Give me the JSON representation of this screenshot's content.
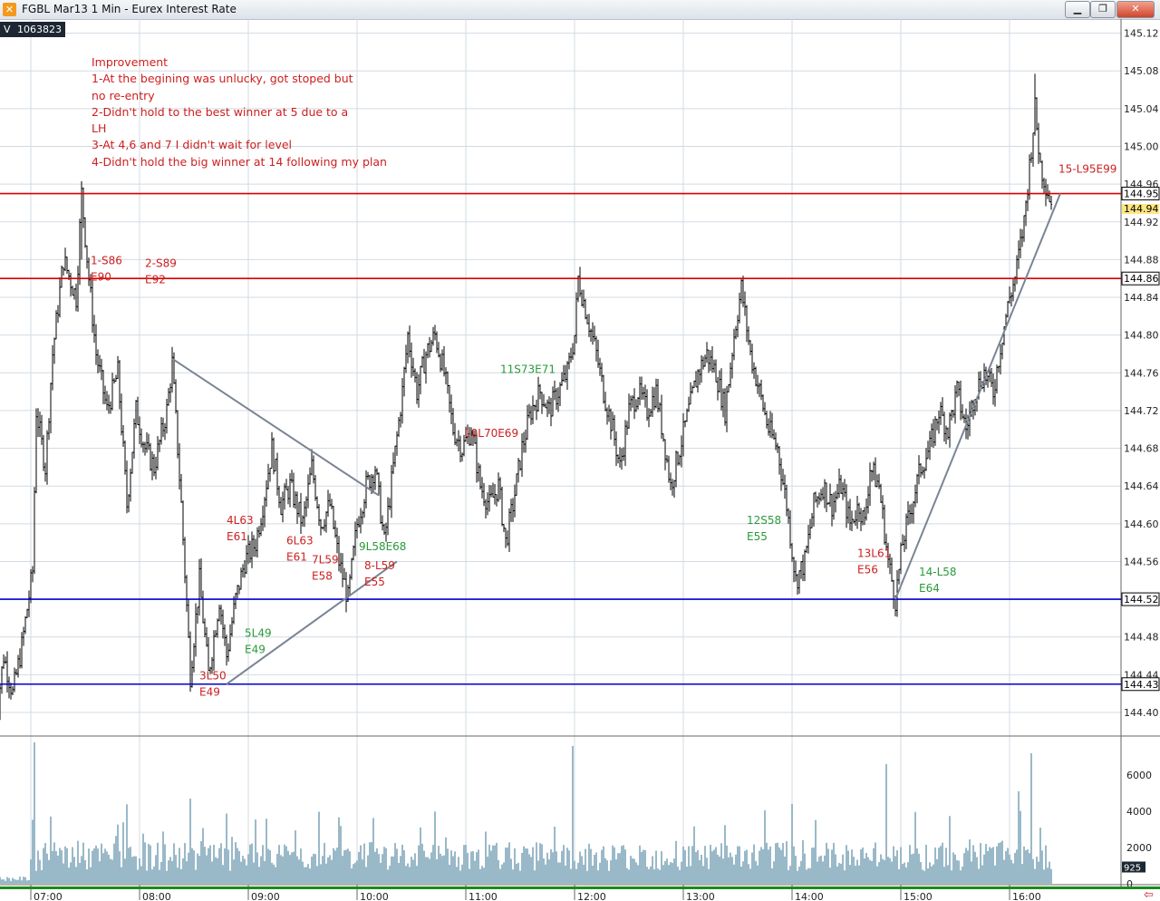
{
  "window": {
    "title": "FGBL Mar13 1 Min - Eurex Interest Rate",
    "buttons": {
      "minimize": "▁",
      "restore": "❐",
      "close": "✕"
    }
  },
  "volume_badge": {
    "label": "V",
    "value": "1063823"
  },
  "notes": [
    "Improvement",
    "1-At the begining was unlucky, got stoped but",
    "no re-entry",
    " 2-Didn't hold to the best winner at 5 due to a",
    "LH",
    "3-At 4,6 and 7 I didn't wait for level",
    "4-Didn't hold the big winner at 14 following my plan"
  ],
  "colors": {
    "candles": "#000000",
    "resistance": "#dd0000",
    "support": "#0000cc",
    "trendline": "#7a8494",
    "short_label": "#cc2020",
    "long_label": "#2a9a3a",
    "volume_bar": "#6f9bb0",
    "current_price_tag": "#ffe680"
  },
  "chart_data": {
    "type": "candlestick",
    "instrument": "FGBL Mar13",
    "timeframe": "1 Min",
    "x_ticks": [
      "07:00",
      "08:00",
      "09:00",
      "10:00",
      "11:00",
      "12:00",
      "13:00",
      "14:00",
      "15:00",
      "16:00"
    ],
    "y_ticks": [
      "145.12",
      "145.08",
      "145.04",
      "145.00",
      "144.96",
      "144.92",
      "144.88",
      "144.84",
      "144.80",
      "144.76",
      "144.72",
      "144.68",
      "144.64",
      "144.60",
      "144.56",
      "144.52",
      "144.48",
      "144.44",
      "144.40"
    ],
    "ylim": [
      144.375,
      145.135
    ],
    "close_path": [
      [
        "06:40",
        144.38
      ],
      [
        "06:45",
        144.46
      ],
      [
        "06:50",
        144.42
      ],
      [
        "06:55",
        144.47
      ],
      [
        "07:01",
        144.55
      ],
      [
        "07:03",
        144.72
      ],
      [
        "07:08",
        144.66
      ],
      [
        "07:12",
        144.78
      ],
      [
        "07:18",
        144.88
      ],
      [
        "07:25",
        144.84
      ],
      [
        "07:28",
        144.95
      ],
      [
        "07:32",
        144.86
      ],
      [
        "07:36",
        144.78
      ],
      [
        "07:42",
        144.72
      ],
      [
        "07:48",
        144.76
      ],
      [
        "07:53",
        144.62
      ],
      [
        "07:58",
        144.72
      ],
      [
        "08:03",
        144.68
      ],
      [
        "08:08",
        144.66
      ],
      [
        "08:15",
        144.72
      ],
      [
        "08:18",
        144.77
      ],
      [
        "08:23",
        144.62
      ],
      [
        "08:28",
        144.44
      ],
      [
        "08:33",
        144.54
      ],
      [
        "08:38",
        144.44
      ],
      [
        "08:44",
        144.52
      ],
      [
        "08:48",
        144.46
      ],
      [
        "08:53",
        144.52
      ],
      [
        "08:58",
        144.56
      ],
      [
        "09:04",
        144.58
      ],
      [
        "09:08",
        144.62
      ],
      [
        "09:13",
        144.68
      ],
      [
        "09:18",
        144.62
      ],
      [
        "09:23",
        144.64
      ],
      [
        "09:30",
        144.6
      ],
      [
        "09:35",
        144.66
      ],
      [
        "09:40",
        144.6
      ],
      [
        "09:45",
        144.62
      ],
      [
        "09:50",
        144.56
      ],
      [
        "09:55",
        144.52
      ],
      [
        "10:00",
        144.6
      ],
      [
        "10:05",
        144.64
      ],
      [
        "10:10",
        144.66
      ],
      [
        "10:15",
        144.58
      ],
      [
        "10:20",
        144.66
      ],
      [
        "10:25",
        144.74
      ],
      [
        "10:28",
        144.8
      ],
      [
        "10:33",
        144.74
      ],
      [
        "10:38",
        144.78
      ],
      [
        "10:43",
        144.8
      ],
      [
        "10:48",
        144.76
      ],
      [
        "10:53",
        144.7
      ],
      [
        "10:58",
        144.68
      ],
      [
        "11:03",
        144.7
      ],
      [
        "11:08",
        144.64
      ],
      [
        "11:13",
        144.62
      ],
      [
        "11:18",
        144.64
      ],
      [
        "11:22",
        144.58
      ],
      [
        "11:26",
        144.62
      ],
      [
        "11:31",
        144.68
      ],
      [
        "11:36",
        144.72
      ],
      [
        "11:41",
        144.74
      ],
      [
        "11:46",
        144.72
      ],
      [
        "11:51",
        144.74
      ],
      [
        "11:56",
        144.76
      ],
      [
        "12:00",
        144.8
      ],
      [
        "12:02",
        144.86
      ],
      [
        "12:07",
        144.82
      ],
      [
        "12:12",
        144.78
      ],
      [
        "12:16",
        144.74
      ],
      [
        "12:21",
        144.7
      ],
      [
        "12:25",
        144.66
      ],
      [
        "12:30",
        144.72
      ],
      [
        "12:35",
        144.74
      ],
      [
        "12:40",
        144.72
      ],
      [
        "12:45",
        144.74
      ],
      [
        "12:50",
        144.68
      ],
      [
        "12:53",
        144.64
      ],
      [
        "12:58",
        144.68
      ],
      [
        "13:03",
        144.72
      ],
      [
        "13:08",
        144.76
      ],
      [
        "13:13",
        144.78
      ],
      [
        "13:18",
        144.76
      ],
      [
        "13:23",
        144.72
      ],
      [
        "13:28",
        144.8
      ],
      [
        "13:32",
        144.85
      ],
      [
        "13:37",
        144.78
      ],
      [
        "13:42",
        144.74
      ],
      [
        "13:47",
        144.7
      ],
      [
        "13:52",
        144.68
      ],
      [
        "13:57",
        144.62
      ],
      [
        "14:02",
        144.54
      ],
      [
        "14:07",
        144.56
      ],
      [
        "14:12",
        144.62
      ],
      [
        "14:17",
        144.64
      ],
      [
        "14:22",
        144.62
      ],
      [
        "14:27",
        144.64
      ],
      [
        "14:32",
        144.6
      ],
      [
        "14:37",
        144.62
      ],
      [
        "14:40",
        144.6
      ],
      [
        "14:43",
        144.66
      ],
      [
        "14:48",
        144.64
      ],
      [
        "14:53",
        144.56
      ],
      [
        "14:57",
        144.52
      ],
      [
        "15:01",
        144.58
      ],
      [
        "15:06",
        144.62
      ],
      [
        "15:11",
        144.66
      ],
      [
        "15:16",
        144.68
      ],
      [
        "15:21",
        144.72
      ],
      [
        "15:26",
        144.7
      ],
      [
        "15:31",
        144.74
      ],
      [
        "15:36",
        144.7
      ],
      [
        "15:41",
        144.74
      ],
      [
        "15:46",
        144.76
      ],
      [
        "15:51",
        144.74
      ],
      [
        "15:56",
        144.8
      ],
      [
        "16:00",
        144.84
      ],
      [
        "16:03",
        144.86
      ],
      [
        "16:08",
        144.92
      ],
      [
        "16:11",
        144.98
      ],
      [
        "16:14",
        145.04
      ],
      [
        "16:17",
        144.98
      ],
      [
        "16:20",
        144.96
      ],
      [
        "16:23",
        144.94
      ]
    ],
    "last_price": "144.94",
    "horizontal_levels": [
      {
        "price": 144.95,
        "label": "144.95",
        "kind": "resistance"
      },
      {
        "price": 144.86,
        "label": "144.86",
        "kind": "resistance"
      },
      {
        "price": 144.52,
        "label": "144.52",
        "kind": "support"
      },
      {
        "price": 144.43,
        "label": "144.43",
        "kind": "support"
      }
    ],
    "trendlines": [
      {
        "from": [
          "08:18",
          144.775
        ],
        "to": [
          "10:12",
          144.63
        ]
      },
      {
        "from": [
          "08:48",
          144.43
        ],
        "to": [
          "10:22",
          144.56
        ]
      },
      {
        "from": [
          "14:57",
          144.52
        ],
        "to": [
          "16:28",
          144.95
        ]
      }
    ],
    "trade_labels": [
      {
        "time": "07:33",
        "price": 144.875,
        "lines": [
          "1-S86",
          "E90"
        ],
        "side": "short"
      },
      {
        "time": "08:03",
        "price": 144.872,
        "lines": [
          "2-S89",
          "E92"
        ],
        "side": "short"
      },
      {
        "time": "08:33",
        "price": 144.435,
        "lines": [
          "3L50",
          "E49"
        ],
        "side": "short"
      },
      {
        "time": "08:48",
        "price": 144.6,
        "lines": [
          "4L63",
          "E61"
        ],
        "side": "short"
      },
      {
        "time": "08:58",
        "price": 144.48,
        "lines": [
          "5L49",
          "E49"
        ],
        "side": "long"
      },
      {
        "time": "09:21",
        "price": 144.578,
        "lines": [
          "6L63",
          "E61"
        ],
        "side": "short"
      },
      {
        "time": "09:35",
        "price": 144.558,
        "lines": [
          "7L59",
          "E58"
        ],
        "side": "short"
      },
      {
        "time": "10:04",
        "price": 144.552,
        "lines": [
          "8-L59",
          "E55"
        ],
        "side": "short"
      },
      {
        "time": "10:01",
        "price": 144.572,
        "lines": [
          "9L58E68"
        ],
        "side": "long"
      },
      {
        "time": "10:59",
        "price": 144.692,
        "lines": [
          "10L70E69"
        ],
        "side": "short"
      },
      {
        "time": "11:19",
        "price": 144.76,
        "lines": [
          "11S73E71"
        ],
        "side": "long"
      },
      {
        "time": "13:35",
        "price": 144.6,
        "lines": [
          "12S58",
          "E55"
        ],
        "side": "long"
      },
      {
        "time": "14:36",
        "price": 144.565,
        "lines": [
          "13L61",
          "E56"
        ],
        "side": "short"
      },
      {
        "time": "15:10",
        "price": 144.545,
        "lines": [
          "14-L58",
          "E64"
        ],
        "side": "long"
      },
      {
        "time": "16:27",
        "price": 144.972,
        "lines": [
          "15-L95E99"
        ],
        "side": "short"
      }
    ],
    "volume": {
      "y_ticks": [
        "6000",
        "4000",
        "2000",
        "0"
      ],
      "ylim": [
        0,
        8000
      ],
      "last": "925",
      "spikes": [
        {
          "time": "07:02",
          "value": 7800
        },
        {
          "time": "11:59",
          "value": 7600
        },
        {
          "time": "16:12",
          "value": 7200
        },
        {
          "time": "14:52",
          "value": 6600
        },
        {
          "time": "14:00",
          "value": 4400
        },
        {
          "time": "08:28",
          "value": 4700
        },
        {
          "time": "16:05",
          "value": 5100
        }
      ]
    }
  }
}
